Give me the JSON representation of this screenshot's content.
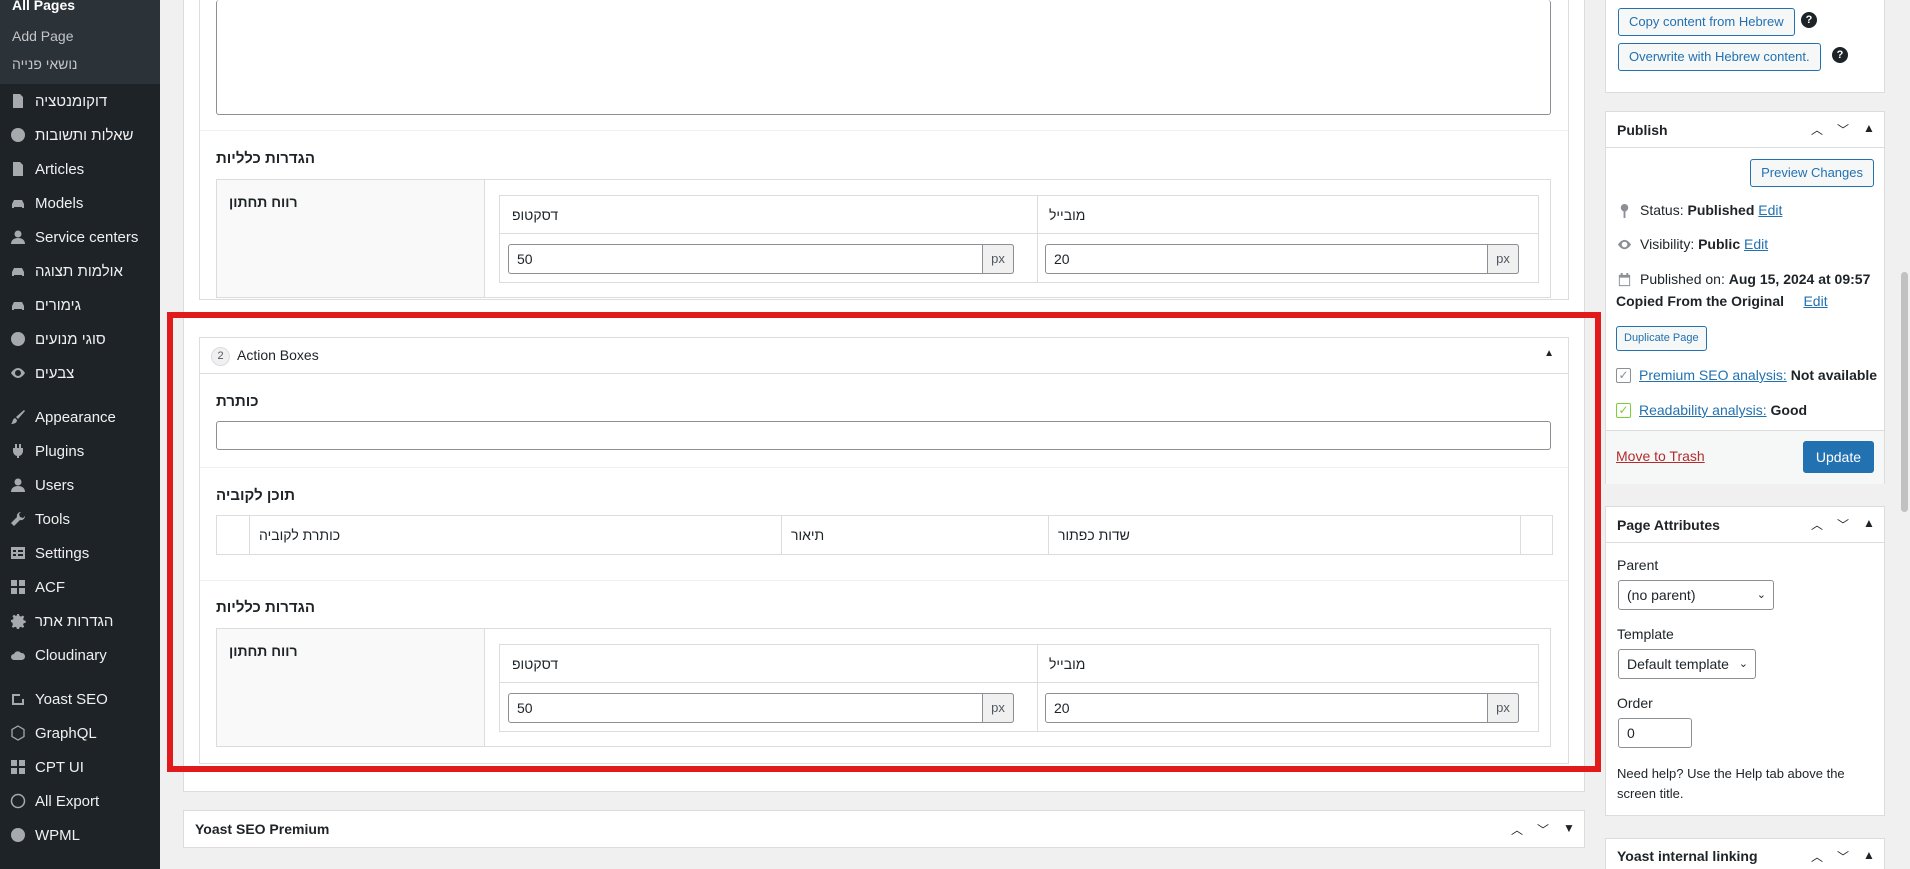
{
  "sidebar": {
    "submenu": [
      "All Pages",
      "Add Page",
      "נושאי פנייה"
    ],
    "items": [
      {
        "label": "דוקומנטציה",
        "icon": "document-icon"
      },
      {
        "label": "שאלות ותשובות",
        "icon": "question-icon"
      },
      {
        "label": "Articles",
        "icon": "document-icon"
      },
      {
        "label": "Models",
        "icon": "car-icon"
      },
      {
        "label": "Service centers",
        "icon": "user-icon"
      },
      {
        "label": "אולמות תצוגה",
        "icon": "car-icon"
      },
      {
        "label": "גימורים",
        "icon": "car-icon"
      },
      {
        "label": "סוגי מנועים",
        "icon": "gauge-icon"
      },
      {
        "label": "צבעים",
        "icon": "eye-icon"
      },
      {
        "label": "Appearance",
        "icon": "brush-icon"
      },
      {
        "label": "Plugins",
        "icon": "plugin-icon"
      },
      {
        "label": "Users",
        "icon": "user-icon"
      },
      {
        "label": "Tools",
        "icon": "wrench-icon"
      },
      {
        "label": "Settings",
        "icon": "settings-icon"
      },
      {
        "label": "ACF",
        "icon": "grid-icon"
      },
      {
        "label": "הגדרות אתר",
        "icon": "gear-icon"
      },
      {
        "label": "Cloudinary",
        "icon": "cloud-icon"
      },
      {
        "label": "Yoast SEO",
        "icon": "yoast-icon"
      },
      {
        "label": "GraphQL",
        "icon": "graphql-icon"
      },
      {
        "label": "CPT UI",
        "icon": "grid-icon"
      },
      {
        "label": "All Export",
        "icon": "export-icon"
      },
      {
        "label": "WPML",
        "icon": "wpml-icon"
      }
    ]
  },
  "main": {
    "general_settings_1": {
      "section_title": "הגדרות כלליות",
      "row_label": "רווח תחתון",
      "desktop_header": "דסקטופ",
      "mobile_header": "מובייל",
      "desktop_value": "50",
      "mobile_value": "20",
      "unit": "px"
    },
    "action_boxes": {
      "order": "2",
      "title": "Action Boxes",
      "collapse_glyph": "▲",
      "heading_label": "כותרת",
      "content_label": "תוכן לקוביה",
      "columns": [
        "כותרת לקוביה",
        "תיאור",
        "שדות כפתור"
      ]
    },
    "general_settings_2": {
      "section_title": "הגדרות כלליות",
      "row_label": "רווח תחתון",
      "desktop_header": "דסקטופ",
      "mobile_header": "מובייל",
      "desktop_value": "50",
      "mobile_value": "20",
      "unit": "px"
    },
    "yoast_premium": {
      "title": "Yoast SEO Premium"
    }
  },
  "right": {
    "wpml": {
      "copy_button": "Copy content from Hebrew",
      "overwrite_button": "Overwrite with Hebrew content.",
      "help_glyph": "?"
    },
    "publish": {
      "title": "Publish",
      "preview_button": "Preview Changes",
      "status_label": "Status:",
      "status_value": "Published",
      "visibility_label": "Visibility:",
      "visibility_value": "Public",
      "edit_link": "Edit",
      "published_on_label": "Published on:",
      "published_on_value": "Aug 15, 2024 at 09:57",
      "copied_text": "Copied From the Original",
      "duplicate_button": "Duplicate Page",
      "seo_link": "Premium SEO analysis:",
      "seo_value": "Not available",
      "readability_link": "Readability analysis:",
      "readability_value": "Good",
      "trash_link": "Move to Trash",
      "update_button": "Update"
    },
    "page_attributes": {
      "title": "Page Attributes",
      "parent_label": "Parent",
      "parent_value": "(no parent)",
      "template_label": "Template",
      "template_value": "Default template",
      "order_label": "Order",
      "order_value": "0",
      "help_text_1": "Need help? Use the Help tab above the",
      "help_text_2": "screen title."
    },
    "yoast_internal": {
      "title": "Yoast internal linking"
    }
  },
  "colors": {
    "sidebar_bg": "#1d2327",
    "accent": "#2271b1",
    "highlight_frame": "#e11b1b",
    "trash": "#b32d2e"
  }
}
